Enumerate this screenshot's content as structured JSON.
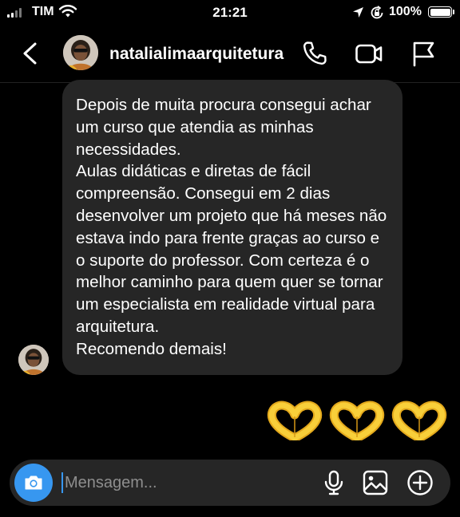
{
  "status_bar": {
    "carrier": "TIM",
    "time": "21:21",
    "battery": "100%",
    "icons": [
      "signal-icon",
      "wifi-icon",
      "location-arrow-icon",
      "rotation-lock-icon",
      "battery-icon"
    ]
  },
  "header": {
    "username": "natalialimaarquitetura",
    "icons": [
      "back-chevron-icon",
      "phone-icon",
      "video-camera-icon",
      "flag-icon"
    ]
  },
  "conversation": {
    "message": {
      "paragraph_1": "Depois de muita procura consegui achar um curso que atendia as minhas necessidades.",
      "paragraph_2": "Aulas didáticas e diretas de fácil compreensão. Consegui em 2 dias desenvolver um projeto que há meses não estava indo para frente graças ao curso e o suporte do professor. Com certeza é o melhor caminho para quem quer se tornar um especialista em realidade virtual para arquitetura.",
      "paragraph_3": "Recomendo demais!"
    },
    "reply_emojis": [
      "heart-hands-emoji",
      "heart-hands-emoji",
      "heart-hands-emoji"
    ]
  },
  "composer": {
    "placeholder": "Mensagem...",
    "icons": [
      "camera-icon",
      "microphone-icon",
      "gallery-icon",
      "add-circle-icon"
    ]
  },
  "colors": {
    "background": "#000000",
    "bubble": "#262626",
    "accent": "#3797f0",
    "emoji": "#f5c52a"
  }
}
